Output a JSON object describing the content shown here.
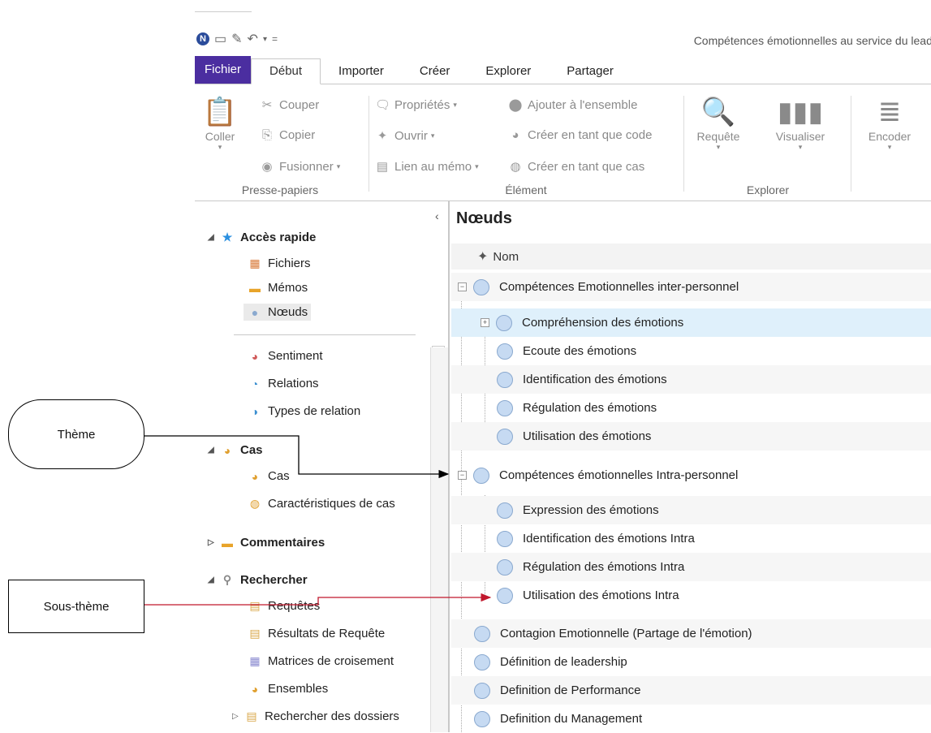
{
  "app_title": "Compétences émotionnelles au service du leadership",
  "tabs": [
    "Fichier",
    "Début",
    "Importer",
    "Créer",
    "Explorer",
    "Partager"
  ],
  "ribbon": {
    "clipboard": {
      "paste": "Coller",
      "cut": "Couper",
      "copy": "Copier",
      "merge": "Fusionner",
      "label": "Presse-papiers"
    },
    "element": {
      "properties": "Propriétés",
      "open": "Ouvrir",
      "link_memo": "Lien au mémo",
      "add_set": "Ajouter à l'ensemble",
      "create_code": "Créer en tant que code",
      "create_case": "Créer en tant que cas",
      "label": "Élément"
    },
    "explore": {
      "query": "Requête",
      "visualize": "Visualiser",
      "label": "Explorer"
    },
    "encode": {
      "label": "Encoder"
    }
  },
  "sidebar": {
    "quick_access": "Accès rapide",
    "files": "Fichiers",
    "memos": "Mémos",
    "nodes": "Nœuds",
    "sentiment": "Sentiment",
    "relations": "Relations",
    "relation_types": "Types de relation",
    "cases_group": "Cas",
    "cases": "Cas",
    "case_characteristics": "Caractéristiques de cas",
    "comments": "Commentaires",
    "search": "Rechercher",
    "queries": "Requêtes",
    "query_results": "Résultats de Requête",
    "matrices": "Matrices de croisement",
    "sets": "Ensembles",
    "search_folders": "Rechercher des dossiers"
  },
  "main": {
    "title": "Nœuds",
    "column_name": "Nom",
    "rows": [
      "Compétences Emotionnelles inter-personnel",
      "Compréhension des émotions",
      "Ecoute des émotions",
      "Identification des émotions",
      "Régulation des émotions",
      "Utilisation des émotions",
      "Compétences émotionnelles Intra-personnel",
      "Expression des émotions",
      "Identification des émotions Intra",
      "Régulation des émotions Intra",
      "Utilisation des émotions Intra",
      "Contagion Emotionnelle (Partage de l'émotion)",
      "Définition de leadership",
      "Definition de Performance",
      "Definition du Management"
    ]
  },
  "callouts": {
    "theme": "Thème",
    "subtheme": "Sous-thème"
  },
  "colors": {
    "file_tab": "#4b2ea0",
    "node_circle": "#c6daf2",
    "highlight_row": "#dff0fb",
    "subtheme_arrow": "#c0172c"
  }
}
